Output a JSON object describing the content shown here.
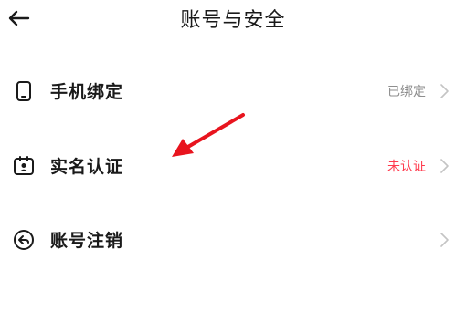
{
  "header": {
    "title": "账号与安全",
    "back_icon": "arrow-left-icon"
  },
  "rows": [
    {
      "icon": "phone-icon",
      "label": "手机绑定",
      "status": "已绑定",
      "status_color": "#8e8e8e"
    },
    {
      "icon": "id-card-icon",
      "label": "实名认证",
      "status": "未认证",
      "status_color": "#ff3b4e"
    },
    {
      "icon": "logout-circle-icon",
      "label": "账号注销",
      "status": ""
    }
  ],
  "annotation": {
    "color": "#e8141e"
  }
}
